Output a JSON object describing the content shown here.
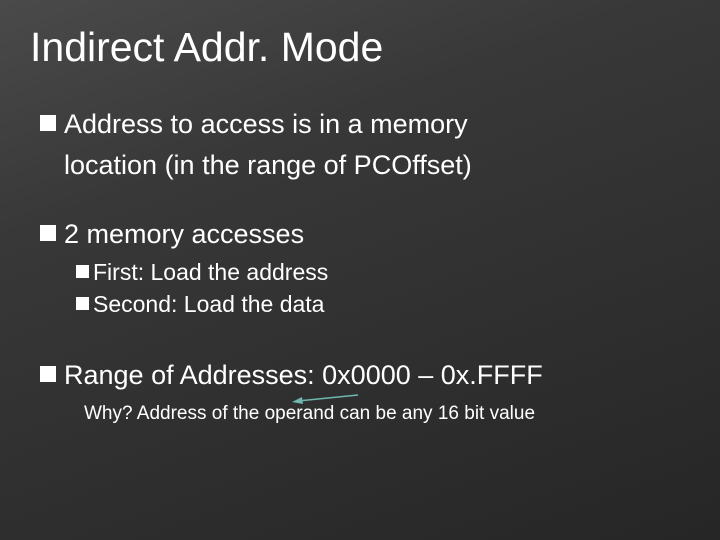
{
  "title": "Indirect Addr. Mode",
  "bullets": {
    "b1_line1": "Address to access is in a memory",
    "b1_line2": "location (in the range of PCOffset)",
    "b2": "2 memory accesses",
    "b2_sub1": "First: Load the address",
    "b2_sub2": "Second: Load the data",
    "b3": "Range of Addresses: 0x0000 – 0x.FFFF"
  },
  "why": "Why? Address of the operand can be any 16 bit value"
}
